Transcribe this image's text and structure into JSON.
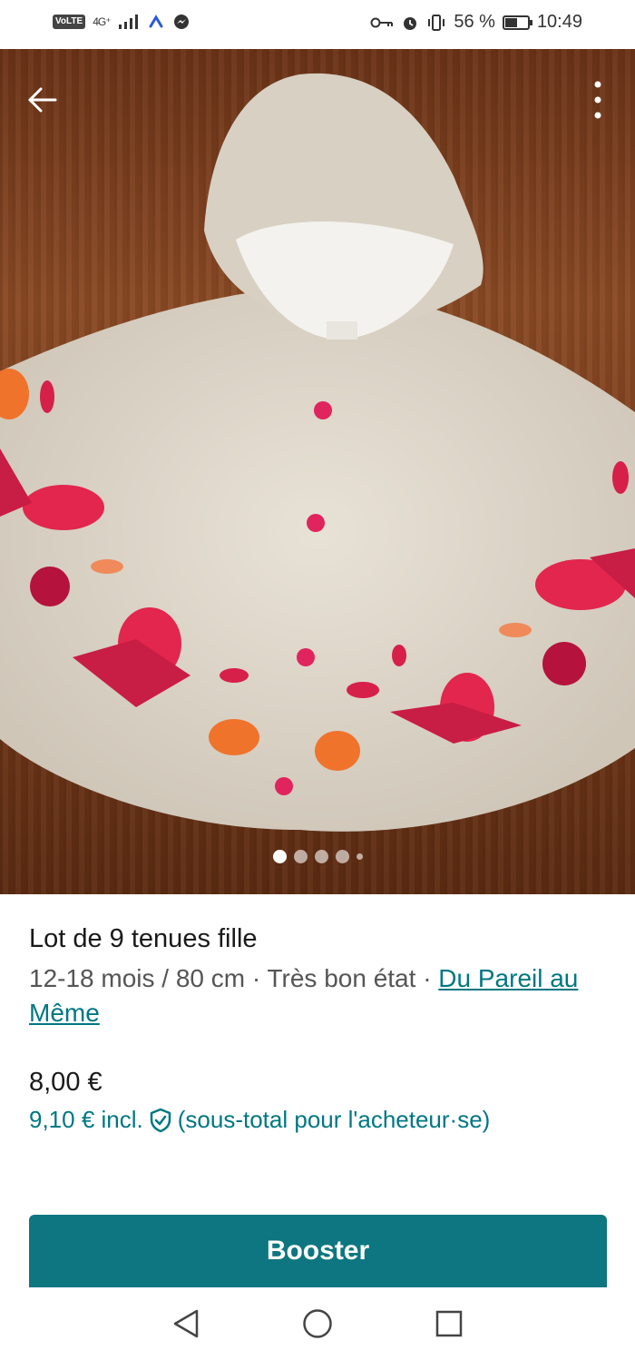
{
  "status_bar": {
    "volte": "VoLTE",
    "network": "4G⁺",
    "battery_pct": "56 %",
    "battery_level": 0.56,
    "time": "10:49"
  },
  "gallery": {
    "image_count": 5,
    "active_index": 0
  },
  "listing": {
    "title": "Lot de 9 tenues fille",
    "meta": "12-18 mois / 80 cm · Très bon état · ",
    "brand": "Du Pareil au Même",
    "price": "8,00 €",
    "price_incl": "9,10 € incl.",
    "price_incl_note": "(sous-total pour l'acheteur·se)"
  },
  "actions": {
    "boost_label": "Booster"
  },
  "colors": {
    "accent": "#007782",
    "button": "#0e7680"
  },
  "icons": [
    "back-arrow-icon",
    "more-vertical-icon",
    "shield-check-icon",
    "nav-back-icon",
    "nav-home-icon",
    "nav-recents-icon"
  ]
}
